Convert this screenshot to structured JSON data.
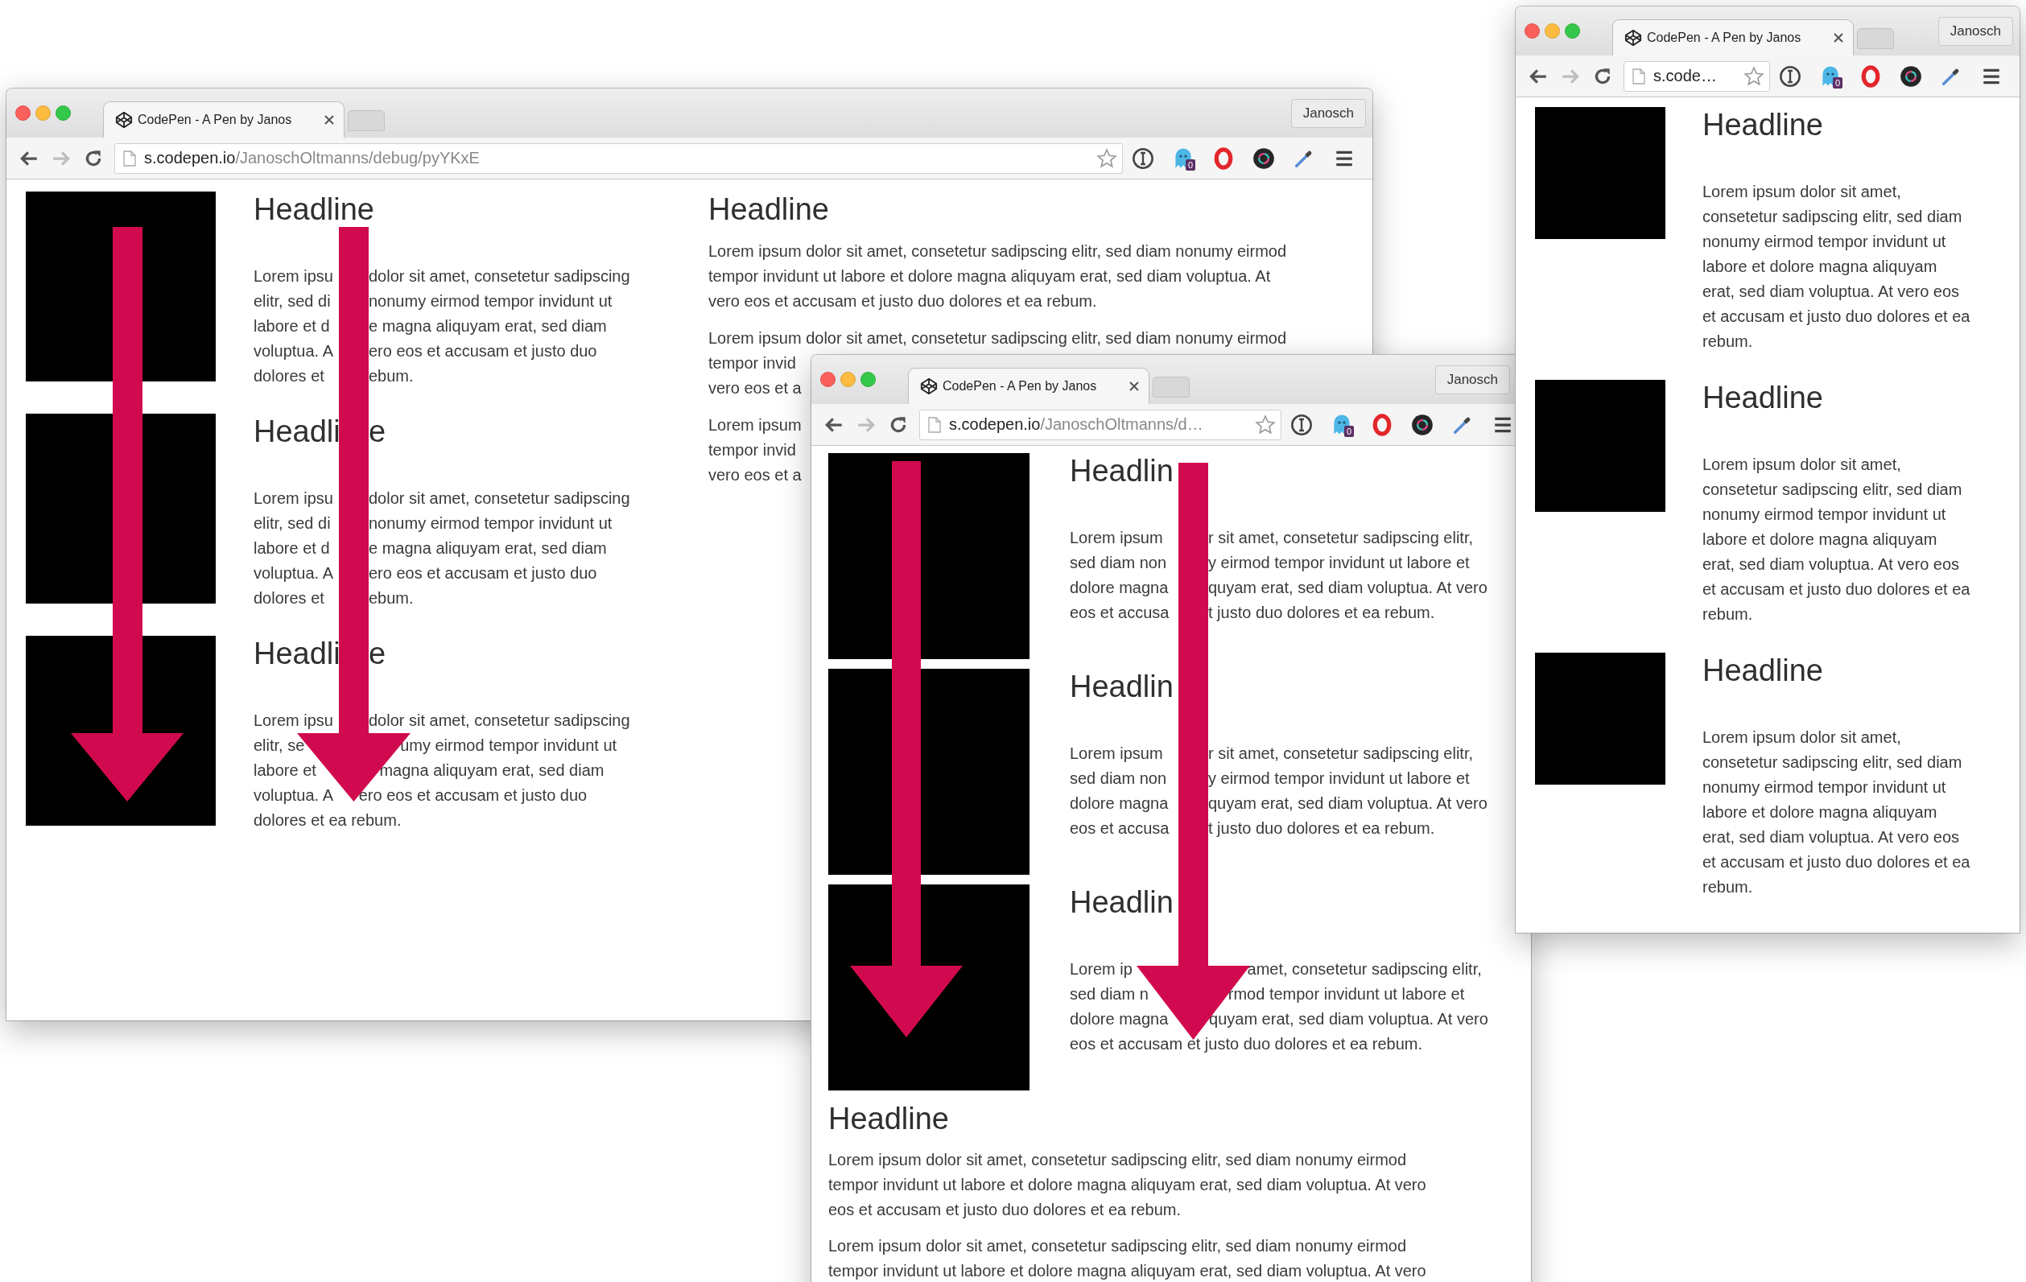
{
  "windows": [
    {
      "kind": "wide",
      "tab": {
        "title": "CodePen - A Pen by Janos"
      },
      "profile": "Janosch",
      "address": {
        "host": "s.codepen.io",
        "path": "/JanoschOltmanns/debug/pyYKxE"
      },
      "extension_badge": "0",
      "items": [
        {
          "headline": [
            "Headline"
          ],
          "lines": [
            [
              "Lorem ipsu",
              "dolor sit amet, consetetur sadipscing"
            ],
            [
              "elitr, sed di",
              "nonumy eirmod tempor invidunt ut"
            ],
            [
              "labore et d",
              "e magna aliquyam erat, sed diam"
            ],
            [
              "voluptua. A",
              "ero eos et accusam et justo duo"
            ],
            [
              "dolores et",
              "ebum."
            ]
          ]
        },
        {
          "headline": [
            "Headli",
            "e"
          ],
          "lines": [
            [
              "Lorem ipsu",
              "dolor sit amet, consetetur sadipscing"
            ],
            [
              "elitr, sed di",
              "nonumy eirmod tempor invidunt ut"
            ],
            [
              "labore et d",
              "e magna aliquyam erat, sed diam"
            ],
            [
              "voluptua. A",
              "ero eos et accusam et justo duo"
            ],
            [
              "dolores et",
              "ebum."
            ]
          ]
        },
        {
          "headline": [
            "Headli",
            "e"
          ],
          "lines": [
            [
              "Lorem ipsu",
              "dolor sit amet, consetetur sadipscing"
            ],
            [
              "elitr, se",
              "umy eirmod tempor invidunt ut"
            ],
            [
              "labore et",
              "magna aliquyam erat, sed diam"
            ],
            [
              "voluptua. A",
              "ero eos et accusam et justo duo"
            ],
            [
              "dolores et ea rebum."
            ]
          ]
        }
      ],
      "extra": {
        "headline": "Headline",
        "paragraphs": [
          [
            "Lorem ipsum dolor sit amet, consetetur sadipscing elitr, sed diam nonumy eirmod",
            "tempor invidunt ut labore et dolore magna aliquyam erat, sed diam voluptua. At",
            "vero eos et accusam et justo duo dolores et ea rebum."
          ],
          [
            "Lorem ipsum dolor sit amet, consetetur sadipscing elitr, sed diam nonumy eirmod",
            "tempor invid",
            "vero eos et a"
          ],
          [
            "Lorem ipsum",
            "tempor invid",
            "vero eos et a"
          ]
        ]
      }
    },
    {
      "kind": "medium",
      "tab": {
        "title": "CodePen - A Pen by Janos"
      },
      "profile": "Janosch",
      "address": {
        "host": "s.codepen.io",
        "path": "/JanoschOltmanns/d…"
      },
      "extension_badge": "0",
      "items": [
        {
          "headline": [
            "Headlin"
          ],
          "lines": [
            [
              "Lorem ipsum",
              "r sit amet, consetetur sadipscing elitr,"
            ],
            [
              "sed diam non",
              "y eirmod tempor invidunt ut labore et"
            ],
            [
              "dolore magna",
              "quyam erat, sed diam voluptua. At vero"
            ],
            [
              "eos et accusa",
              "t justo duo dolores et ea rebum."
            ]
          ]
        },
        {
          "headline": [
            "Headlin"
          ],
          "lines": [
            [
              "Lorem ipsum",
              "r sit amet, consetetur sadipscing elitr,"
            ],
            [
              "sed diam non",
              "y eirmod tempor invidunt ut labore et"
            ],
            [
              "dolore magna",
              "quyam erat, sed diam voluptua. At vero"
            ],
            [
              "eos et accusa",
              "t justo duo dolores et ea rebum."
            ]
          ]
        },
        {
          "headline": [
            "Headlin"
          ],
          "lines": [
            [
              "Lorem ip",
              "amet, consetetur sadipscing elitr,"
            ],
            [
              "sed diam n",
              "rmod tempor invidunt ut labore et"
            ],
            [
              "dolore magna",
              "quyam erat, sed diam voluptua. At vero"
            ],
            [
              "eos et accusam et justo duo dolores et ea rebum."
            ]
          ]
        }
      ],
      "extra": {
        "headline": "Headline",
        "paragraphs": [
          [
            "Lorem ipsum dolor sit amet, consetetur sadipscing elitr, sed diam nonumy eirmod",
            "tempor invidunt ut labore et dolore magna aliquyam erat, sed diam voluptua. At vero",
            "eos et accusam et justo duo dolores et ea rebum."
          ],
          [
            "Lorem ipsum dolor sit amet, consetetur sadipscing elitr, sed diam nonumy eirmod",
            "tempor invidunt ut labore et dolore magna aliquyam erat, sed diam voluptua. At vero"
          ]
        ]
      }
    },
    {
      "kind": "narrow",
      "tab": {
        "title": "CodePen - A Pen by Janos"
      },
      "profile": "Janosch",
      "address": {
        "host": "s.code…"
      },
      "extension_badge": "0",
      "items": [
        {
          "headline": [
            "Headline"
          ],
          "lines": [
            [
              "Lorem ipsum dolor sit amet,"
            ],
            [
              "consetetur sadipscing elitr, sed diam"
            ],
            [
              "nonumy eirmod tempor invidunt ut"
            ],
            [
              "labore et dolore magna aliquyam"
            ],
            [
              "erat, sed diam voluptua. At vero eos"
            ],
            [
              "et accusam et justo duo dolores et ea"
            ],
            [
              "rebum."
            ]
          ]
        },
        {
          "headline": [
            "Headline"
          ],
          "lines": [
            [
              "Lorem ipsum dolor sit amet,"
            ],
            [
              "consetetur sadipscing elitr, sed diam"
            ],
            [
              "nonumy eirmod tempor invidunt ut"
            ],
            [
              "labore et dolore magna aliquyam"
            ],
            [
              "erat, sed diam voluptua. At vero eos"
            ],
            [
              "et accusam et justo duo dolores et ea"
            ],
            [
              "rebum."
            ]
          ]
        },
        {
          "headline": [
            "Headline"
          ],
          "lines": [
            [
              "Lorem ipsum dolor sit amet,"
            ],
            [
              "consetetur sadipscing elitr, sed diam"
            ],
            [
              "nonumy eirmod tempor invidunt ut"
            ],
            [
              "labore et dolore magna aliquyam"
            ],
            [
              "erat, sed diam voluptua. At vero eos"
            ],
            [
              "et accusam et justo duo dolores et ea"
            ],
            [
              "rebum."
            ]
          ]
        }
      ]
    }
  ]
}
